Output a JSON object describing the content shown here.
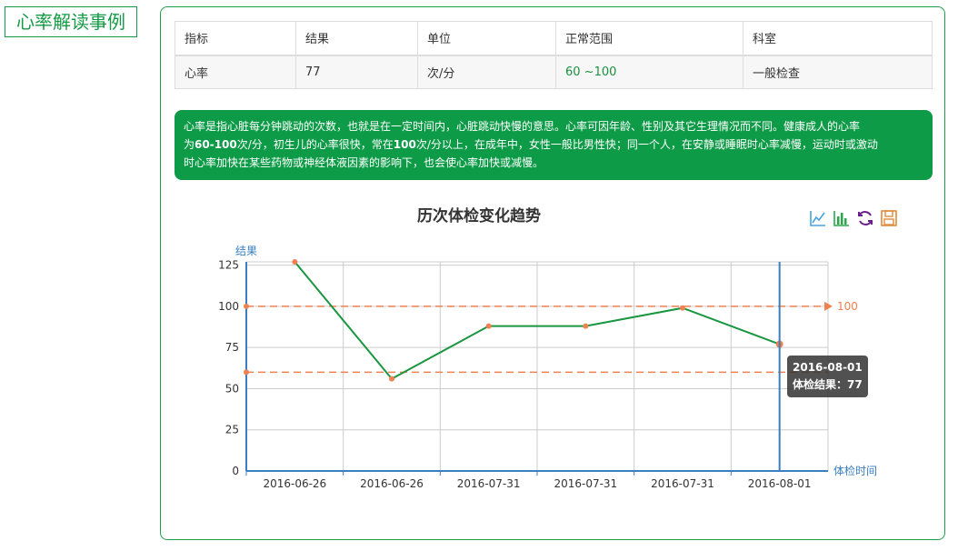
{
  "page_label": "心率解读事例",
  "table": {
    "headers": [
      "指标",
      "结果",
      "单位",
      "正常范围",
      "科室"
    ],
    "row": [
      "心率",
      "77",
      "次/分",
      "60 ~100",
      "一般检查"
    ]
  },
  "info": {
    "line1": "心率是指心脏每分钟跳动的次数，也就是在一定时间内，心脏跳动快慢的意思。心率可因年龄、性别及其它生理情况而不同。健康成人的心率",
    "line2_pre": "为",
    "line2_bold": "60-100",
    "line2_post": "次/分，初生儿的心率很快，常在",
    "line2_bold2": "100",
    "line2_post2": "次/分以上，在成年中，女性一般比男性快；同一个人，在安静或睡眠时心率减慢，运动时或激动",
    "line3": "时心率加快在某些药物或神经体液因素的影响下，也会使心率加快或减慢。"
  },
  "chart_data": {
    "type": "line",
    "title": "历次体检变化趋势",
    "ylabel": "结果",
    "xlabel": "体检时间",
    "categories": [
      "2016-06-26",
      "2016-06-26",
      "2016-07-31",
      "2016-07-31",
      "2016-07-31",
      "2016-08-01"
    ],
    "series": [
      {
        "values": [
          127,
          56,
          88,
          88,
          99,
          77
        ]
      }
    ],
    "yticks": [
      0,
      25,
      50,
      75,
      100,
      125
    ],
    "ylim": [
      0,
      127
    ],
    "grid": true,
    "reference_lines": [
      {
        "value": 100,
        "label": "100",
        "color": "#f08050"
      },
      {
        "value": 60,
        "label": "",
        "color": "#f08050"
      }
    ],
    "line_color": "#1a9641",
    "point_color": "#f08050",
    "axis_color": "#3a7fbf"
  },
  "tooltip": {
    "date": "2016-08-01",
    "text": "体检结果：77"
  },
  "toolbar": {
    "icons": [
      "line-chart-icon",
      "bar-chart-icon",
      "refresh-icon",
      "save-icon"
    ]
  },
  "colors": {
    "brand_green": "#149b46",
    "info_bg": "#0d9b47"
  }
}
